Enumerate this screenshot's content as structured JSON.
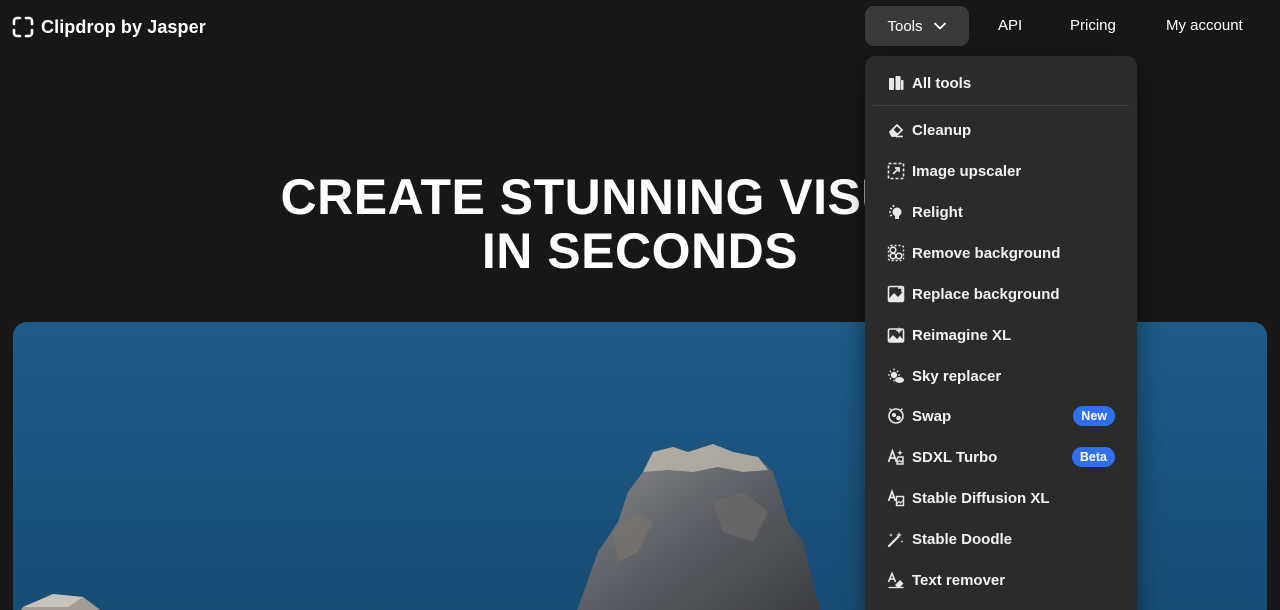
{
  "header": {
    "logo_text": "Clipdrop",
    "logo_by": "by Jasper",
    "nav": {
      "tools": "Tools",
      "api": "API",
      "pricing": "Pricing",
      "account": "My account"
    }
  },
  "hero": {
    "title_line1": "CREATE STUNNING VISUALS",
    "title_line2": "IN SECONDS"
  },
  "dropdown": {
    "all_tools": "All tools",
    "items": [
      {
        "label": "Cleanup",
        "icon": "eraser-icon"
      },
      {
        "label": "Image upscaler",
        "icon": "upscale-icon"
      },
      {
        "label": "Relight",
        "icon": "lightbulb-icon"
      },
      {
        "label": "Remove background",
        "icon": "remove-background-icon"
      },
      {
        "label": "Replace background",
        "icon": "replace-background-icon"
      },
      {
        "label": "Reimagine XL",
        "icon": "reimagine-icon"
      },
      {
        "label": "Sky replacer",
        "icon": "sky-icon"
      },
      {
        "label": "Swap",
        "icon": "swap-icon",
        "badge": "New"
      },
      {
        "label": "SDXL Turbo",
        "icon": "text-to-image-icon",
        "badge": "Beta"
      },
      {
        "label": "Stable Diffusion XL",
        "icon": "stable-diffusion-icon"
      },
      {
        "label": "Stable Doodle",
        "icon": "magic-wand-icon"
      },
      {
        "label": "Text remover",
        "icon": "text-eraser-icon"
      }
    ]
  },
  "colors": {
    "background": "#171717",
    "dropdown": "#2b2b2b",
    "badge": "#2f6ff0"
  }
}
